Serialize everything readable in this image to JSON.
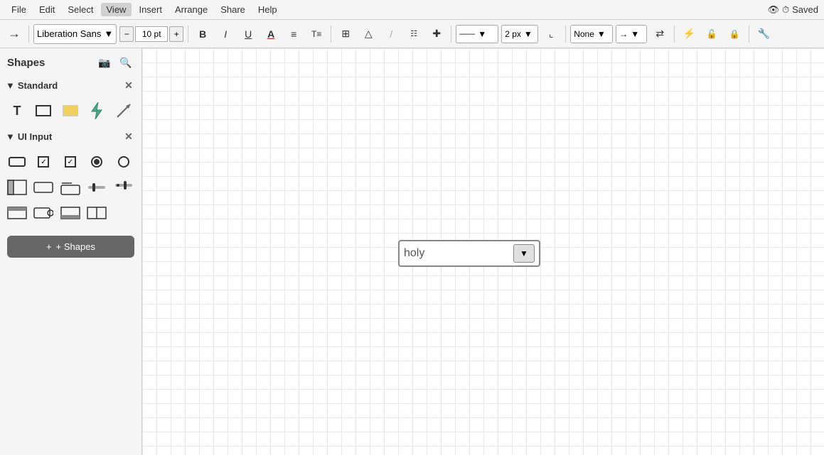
{
  "menubar": {
    "items": [
      "File",
      "Edit",
      "Select",
      "View",
      "Insert",
      "Arrange",
      "Share",
      "Help"
    ],
    "active_item": "View",
    "extras": {
      "icon_label": "👁",
      "saved_label": "Saved"
    }
  },
  "toolbar": {
    "pointer_icon": "→",
    "font_name": "Liberation Sans",
    "font_size": "10 pt",
    "font_size_decrease": "−",
    "font_size_increase": "+",
    "bold_label": "B",
    "italic_label": "I",
    "underline_label": "U",
    "text_color_icon": "A",
    "fill_icon": "⬡",
    "stroke_icon": "/",
    "extra_icons": [
      "⊞",
      "☁",
      "⊘",
      "⋯"
    ],
    "line_style": "——",
    "line_width": "2 px",
    "corner_icon": "⌐",
    "arrow_start": "None",
    "arrow_end": "→",
    "swap_icon": "⇄",
    "bolt_icon": "⚡",
    "lock_open_icon": "🔓",
    "lock_icon": "🔒",
    "wrench_icon": "🔧"
  },
  "sidebar": {
    "title": "Shapes",
    "image_icon": "🖼",
    "search_icon": "🔍",
    "sections": [
      {
        "id": "standard",
        "label": "Standard",
        "shapes": [
          {
            "id": "text",
            "type": "T"
          },
          {
            "id": "rect",
            "type": "rect"
          },
          {
            "id": "rect-yellow",
            "type": "rect-yellow"
          },
          {
            "id": "lightning",
            "type": "lightning"
          },
          {
            "id": "arrow",
            "type": "arrow"
          }
        ]
      },
      {
        "id": "ui-input",
        "label": "UI Input",
        "shapes": [
          {
            "id": "input-outline",
            "type": "input-outline"
          },
          {
            "id": "checkbox-check",
            "type": "checkbox-check"
          },
          {
            "id": "checkbox-x",
            "type": "checkbox-x"
          },
          {
            "id": "radio-filled",
            "type": "radio-filled"
          },
          {
            "id": "radio-empty",
            "type": "radio-empty"
          },
          {
            "id": "panel-top",
            "type": "panel-top"
          },
          {
            "id": "input-small",
            "type": "input-small"
          },
          {
            "id": "input-label",
            "type": "input-label"
          },
          {
            "id": "slider",
            "type": "slider"
          },
          {
            "id": "slider-alt",
            "type": "slider-alt"
          },
          {
            "id": "bar-bottom",
            "type": "bar-bottom"
          },
          {
            "id": "search-bar",
            "type": "search-bar"
          },
          {
            "id": "status-bar",
            "type": "status-bar"
          },
          {
            "id": "split-panel",
            "type": "split-panel"
          }
        ]
      }
    ],
    "add_button_label": "+ Shapes"
  },
  "canvas": {
    "dropdown": {
      "text": "holy",
      "button_symbol": "▼"
    }
  }
}
